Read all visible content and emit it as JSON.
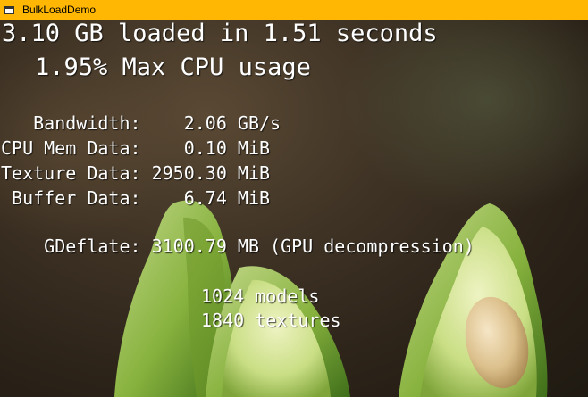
{
  "window": {
    "title": "BulkLoadDemo"
  },
  "summary": {
    "load_line": "3.10 GB loaded in 1.51 seconds",
    "cpu_line": "1.95% Max CPU usage"
  },
  "stats": [
    {
      "label": "   Bandwidth:",
      "value": "    2.06 GB/s"
    },
    {
      "label": "CPU Mem Data:",
      "value": "    0.10 MiB"
    },
    {
      "label": "Texture Data:",
      "value": " 2950.30 MiB"
    },
    {
      "label": " Buffer Data:",
      "value": "    6.74 MiB"
    }
  ],
  "gdeflate": {
    "label": "    GDeflate:",
    "value": " 3100.79 MB (GPU decompression)"
  },
  "counts": [
    {
      "value": "1024",
      "label": "models"
    },
    {
      "value": "1840",
      "label": "textures"
    }
  ]
}
